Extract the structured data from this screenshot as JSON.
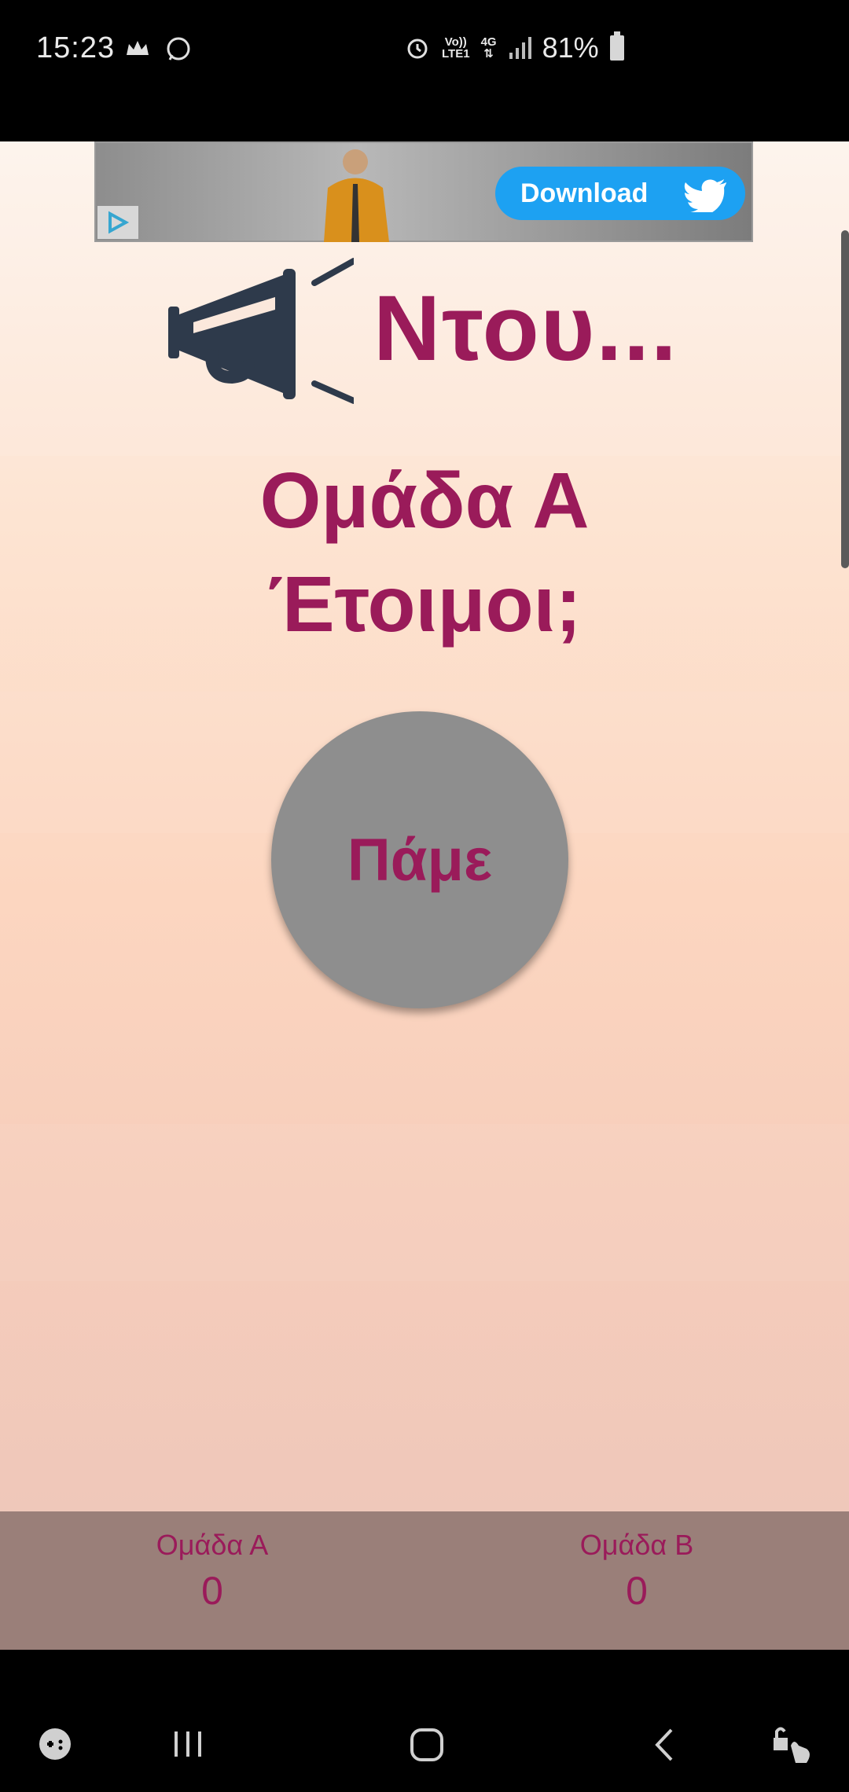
{
  "status_bar": {
    "time": "15:23",
    "network_top": "Vo))",
    "network_bottom": "LTE1",
    "gen": "4G",
    "battery": "81%"
  },
  "ad": {
    "button_label": "Download"
  },
  "header": {
    "title": "Ντου..."
  },
  "main": {
    "team_name": "Ομάδα Α",
    "ready_question": "Έτοιμοι;",
    "go_button": "Πάμε"
  },
  "scores": [
    {
      "label": "Ομάδα Α",
      "value": "0"
    },
    {
      "label": "Ομάδα Β",
      "value": "0"
    }
  ],
  "colors": {
    "accent": "#9a1b5a",
    "button": "#8e8e8e",
    "score_bar": "#9a7f79"
  }
}
